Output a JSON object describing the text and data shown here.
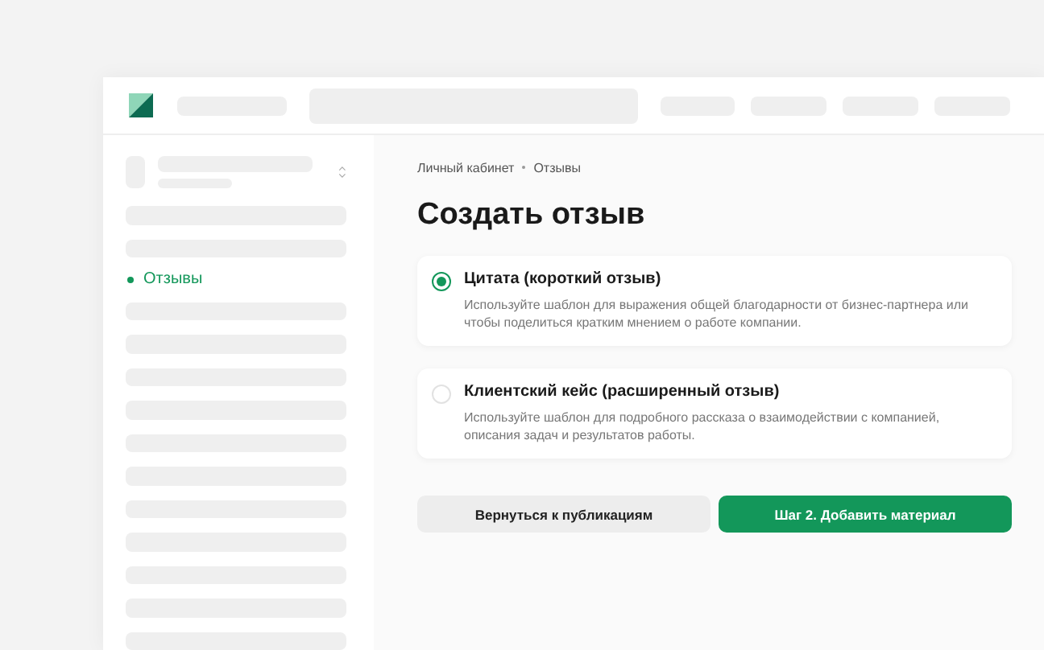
{
  "breadcrumbs": [
    "Личный кабинет",
    "Отзывы"
  ],
  "title": "Создать отзыв",
  "sidebar": {
    "items": [
      {
        "kind": "placeholder"
      },
      {
        "kind": "placeholder"
      },
      {
        "kind": "link",
        "label": "Отзывы",
        "selected": true
      },
      {
        "kind": "placeholder"
      },
      {
        "kind": "placeholder"
      },
      {
        "kind": "placeholder"
      },
      {
        "kind": "placeholder"
      },
      {
        "kind": "placeholder"
      },
      {
        "kind": "placeholder"
      },
      {
        "kind": "placeholder"
      },
      {
        "kind": "placeholder"
      },
      {
        "kind": "placeholder"
      },
      {
        "kind": "placeholder"
      },
      {
        "kind": "placeholder"
      }
    ]
  },
  "options": [
    {
      "title": "Цитата (короткий отзыв)",
      "description": "Используйте шаблон для выражения общей благодарности от бизнес-партнера или чтобы поделиться кратким мнением о работе компании.",
      "selected": true
    },
    {
      "title": "Клиентский кейс (расширенный отзыв)",
      "description": "Используйте шаблон для подробного рассказа о взаимодействии с компанией, описания задач и результатов работы.",
      "selected": false
    }
  ],
  "buttons": [
    {
      "label": "Вернуться к публикациям",
      "kind": "secondary"
    },
    {
      "label": "Шаг 2. Добавить материал",
      "kind": "primary"
    }
  ]
}
